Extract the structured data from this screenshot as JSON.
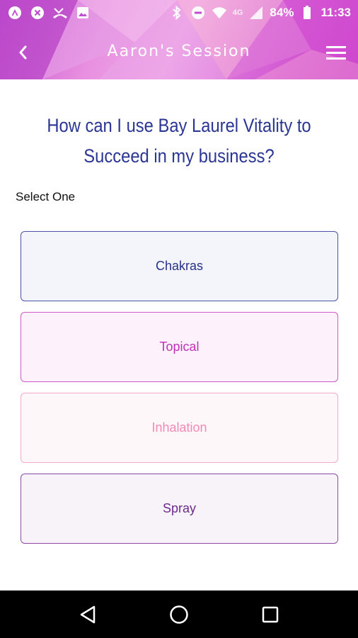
{
  "status_bar": {
    "network_label": "4G",
    "battery_percent": "84%",
    "time": "11:33"
  },
  "app_bar": {
    "title": "Aaron's Session"
  },
  "question": {
    "text": "How can I use Bay Laurel Vitality to Succeed in my business?"
  },
  "select_label": "Select One",
  "options": [
    {
      "label": "Chakras"
    },
    {
      "label": "Topical"
    },
    {
      "label": "Inhalation"
    },
    {
      "label": "Spray"
    }
  ],
  "colors": {
    "header_pink": "#d96ad8",
    "question_blue": "#2a3594",
    "option1": "#27318a",
    "option2": "#c22fb8",
    "option3": "#f08ab4",
    "option4": "#6e2a8c"
  },
  "icons": {
    "status_left": [
      "app-notification-icon",
      "cancel-circle-icon",
      "missed-call-icon",
      "image-icon"
    ],
    "status_right": [
      "bluetooth-icon",
      "do-not-disturb-icon",
      "wifi-icon",
      "battery-icon"
    ],
    "app_bar": [
      "back-arrow-icon",
      "hamburger-menu-icon"
    ],
    "nav": [
      "nav-back-icon",
      "nav-home-icon",
      "nav-recents-icon"
    ]
  }
}
